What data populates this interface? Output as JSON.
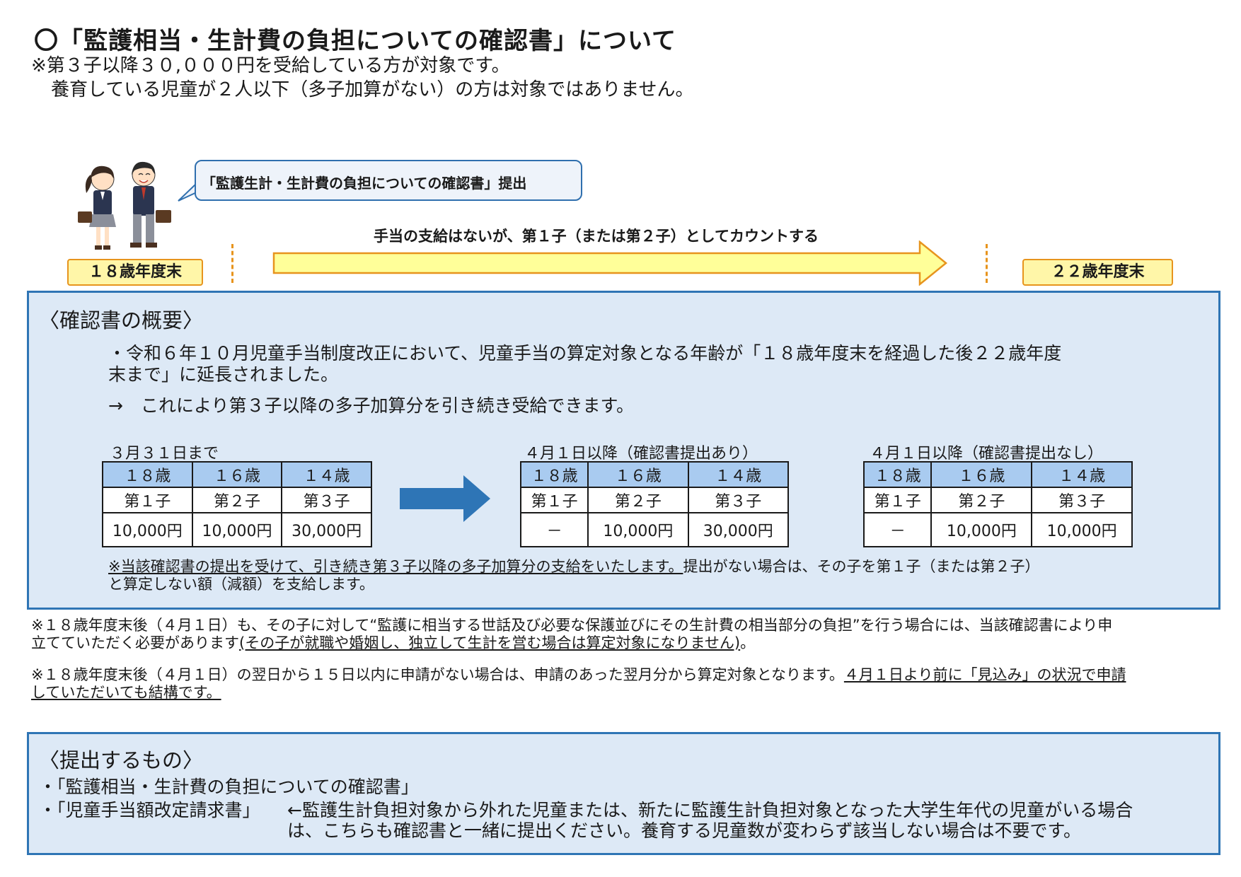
{
  "header": {
    "title": "〇「監護相当・生計費の負担についての確認書」について",
    "note_line1": "※第３子以降３０,０００円を受給している方が対象です。",
    "note_line2": "養育している児童が２人以下（多子加算がない）の方は対象ではありません。"
  },
  "timeline": {
    "bubble_text": "「監護生計・生計費の負担についての確認書」提出",
    "arrow_label": "手当の支給はないが、第１子（または第２子）としてカウントする",
    "start_label": "１８歳年度末",
    "end_label": "２２歳年度末"
  },
  "overview": {
    "heading": "〈確認書の概要〉",
    "bullet_line1": "・令和６年１０月児童手当制度改正において、児童手当の算定対象となる年齢が「１８歳年度末を経過した後２２歳年度",
    "bullet_line2": "末まで」に延長されました。",
    "arrow_line": "→　これにより第３子以降の多子加算分を引き続き受給できます。",
    "tables": [
      {
        "caption": "３月３１日まで",
        "ages": [
          "１８歳",
          "１６歳",
          "１４歳"
        ],
        "ranks": [
          "第１子",
          "第２子",
          "第３子"
        ],
        "amounts": [
          "10,000円",
          "10,000円",
          "30,000円"
        ]
      },
      {
        "caption": "４月１日以降（確認書提出あり）",
        "ages": [
          "１８歳",
          "１６歳",
          "１４歳"
        ],
        "ranks": [
          "第１子",
          "第２子",
          "第３子"
        ],
        "amounts": [
          "－",
          "10,000円",
          "30,000円"
        ]
      },
      {
        "caption": "４月１日以降（確認書提出なし）",
        "ages": [
          "１８歳",
          "１６歳",
          "１４歳"
        ],
        "ranks": [
          "第１子",
          "第２子",
          "第３子"
        ],
        "amounts": [
          "－",
          "10,000円",
          "10,000円"
        ]
      }
    ],
    "note_underlined": "※当該確認書の提出を受けて、引き続き第３子以降の多子加算分の支給をいたします。",
    "note_rest": "提出がない場合は、その子を第１子（または第２子）",
    "note_line2": "と算定しない額（減額）を支給します。"
  },
  "notes": {
    "n1_line1": "※１８歳年度末後（４月１日）も、その子に対して“監護に相当する世話及び必要な保護並びにその生計費の相当部分の負担”を行う場合には、当該確認書により申",
    "n1_line2a": "立てていただく必要があります",
    "n1_line2b": "(その子が就職や婚姻し、独立して生計を営む場合は算定対象になりません)",
    "n1_line2c": "。",
    "n2_line1a": "※１８歳年度末後（４月１日）の翌日から１５日以内に申請がない場合は、申請のあった翌月分から算定対象となります。",
    "n2_line1b": "４月１日より前に「見込み」の状況で申請",
    "n2_line2": "していただいても結構です。"
  },
  "submit": {
    "heading": "〈提出するもの〉",
    "item1": "・「監護相当・生計費の負担についての確認書」",
    "item2_label": "・「児童手当額改定請求書」",
    "item2_desc1": "←監護生計負担対象から外れた児童または、新たに監護生計負担対象となった大学生年代の児童がいる場合",
    "item2_desc2": "は、こちらも確認書と一緒に提出ください。養育する児童数が変わらず該当しない場合は不要です。"
  },
  "colors": {
    "panel_border": "#2f75b5",
    "panel_bg": "#dde9f6",
    "table_header": "#a9cbf0",
    "age_box_border": "#e7941d",
    "age_box_fill": "#fff6a8",
    "yellow_arrow": "#ffff99",
    "blue_arrow": "#2e75b6"
  }
}
